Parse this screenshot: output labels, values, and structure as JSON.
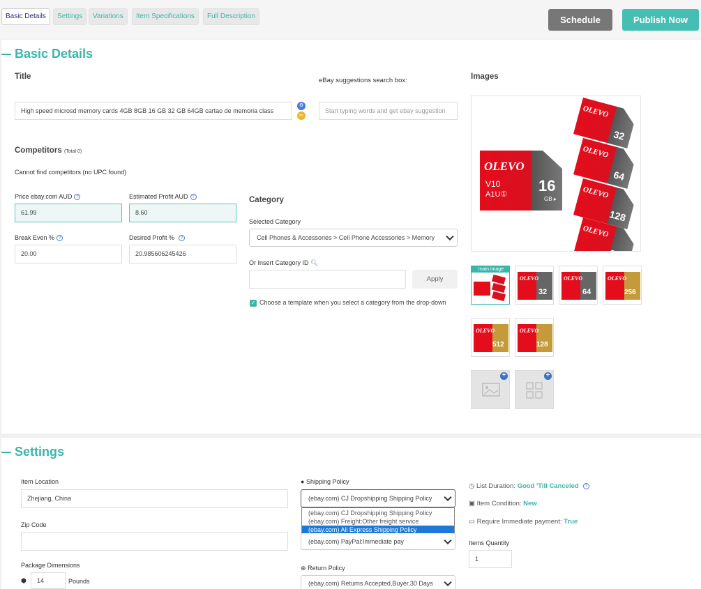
{
  "tabs": [
    {
      "label": "Basic Details",
      "active": true
    },
    {
      "label": "Settings"
    },
    {
      "label": "Variations"
    },
    {
      "label": "Item Specifications"
    },
    {
      "label": "Full Description"
    }
  ],
  "actions": {
    "schedule": "Schedule",
    "publish": "Publish Now"
  },
  "colors": {
    "accent": "#3bb5ab",
    "schedule_bg": "#777777",
    "selected_option": "#1e78d6"
  },
  "basic": {
    "section_title": "Basic Details",
    "title_label": "Title",
    "title_value": "High speed microsd memory cards 4GB 8GB 16 GB 32 GB 64GB cartao de memoria class",
    "suggest_label": "eBay suggestions search box:",
    "suggest_placeholder": "Start typing words and get ebay suggestion",
    "competitors_label": "Competitors",
    "competitors_total": "(Total 0)",
    "competitors_msg": "Cannot find competitors (no UPC found)",
    "price_label": "Price ebay.com AUD",
    "price_value": "61.99",
    "profit_label": "Estimated Profit AUD",
    "profit_value": "8.60",
    "breakeven_label": "Break Even %",
    "breakeven_value": "20.00",
    "desired_label": "Desired Profit %",
    "desired_value": "20.985606245426",
    "category_header": "Category",
    "selected_category_label": "Selected Category",
    "selected_category_value": "Cell Phones & Accessories > Cell Phone Accessories > Memory",
    "insert_category_label": "Or Insert Category ID",
    "apply_label": "Apply",
    "template_checkbox_label": "Choose a template when you select a category from the drop-down",
    "images_label": "Images",
    "main_image_badge": "main image",
    "card_brand": "OLEVO",
    "main_card_size": "16",
    "thumb_sizes": [
      "32",
      "64",
      "256",
      "512",
      "128"
    ]
  },
  "settings": {
    "section_title": "Settings",
    "location_label": "Item Location",
    "location_value": "Zhejiang, China",
    "zip_label": "Zip Code",
    "zip_value": "",
    "package_label": "Package Dimensions",
    "package_value": "14",
    "package_unit": "Pounds",
    "shipping_label": "Shipping Policy",
    "shipping_value": "(ebay.com) CJ Dropshipping Shipping Policy",
    "shipping_options": [
      "(ebay.com) CJ Dropshipping Shipping Policy",
      "(ebay.com) Freight:Other freight service",
      "(ebay.com) Ali Express Shipping Policy"
    ],
    "payment_value": "(ebay.com) PayPal:Immediate pay",
    "return_label": "Return Policy",
    "return_value": "(ebay.com) Returns Accepted,Buyer,30 Days",
    "duration_label": "List Duration:",
    "duration_value": "Good 'Till Canceled",
    "condition_label": "Item Condition:",
    "condition_value": "New",
    "immediate_label": "Require Immediate payment:",
    "immediate_value": "True",
    "quantity_label": "Items Quantity",
    "quantity_value": "1"
  }
}
